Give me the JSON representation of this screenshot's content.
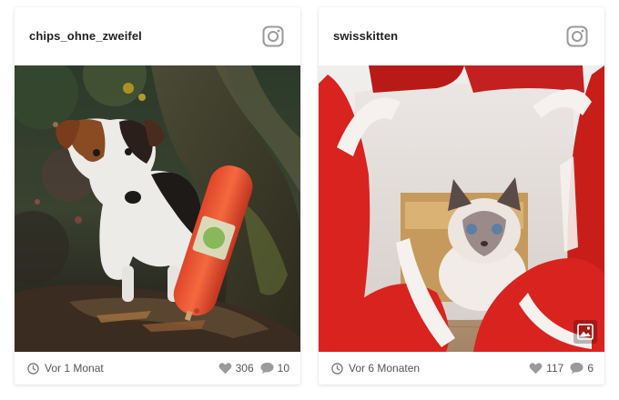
{
  "posts": [
    {
      "username": "chips_ohne_zweifel",
      "icon": "instagram-icon",
      "image_alt": "jack-russell-dog-with-sausage",
      "time": "Vor 1 Monat",
      "likes": "306",
      "comments": "10"
    },
    {
      "username": "swisskitten",
      "icon": "instagram-icon",
      "image_alt": "kitten-in-red-bag",
      "time": "Vor 6 Monaten",
      "likes": "117",
      "comments": "6",
      "badge_icon": "image-gallery-icon"
    }
  ],
  "colors": {
    "text": "#222222",
    "meta": "#555555",
    "icon": "#9a9a9a",
    "bag_red": "#d9231f"
  }
}
